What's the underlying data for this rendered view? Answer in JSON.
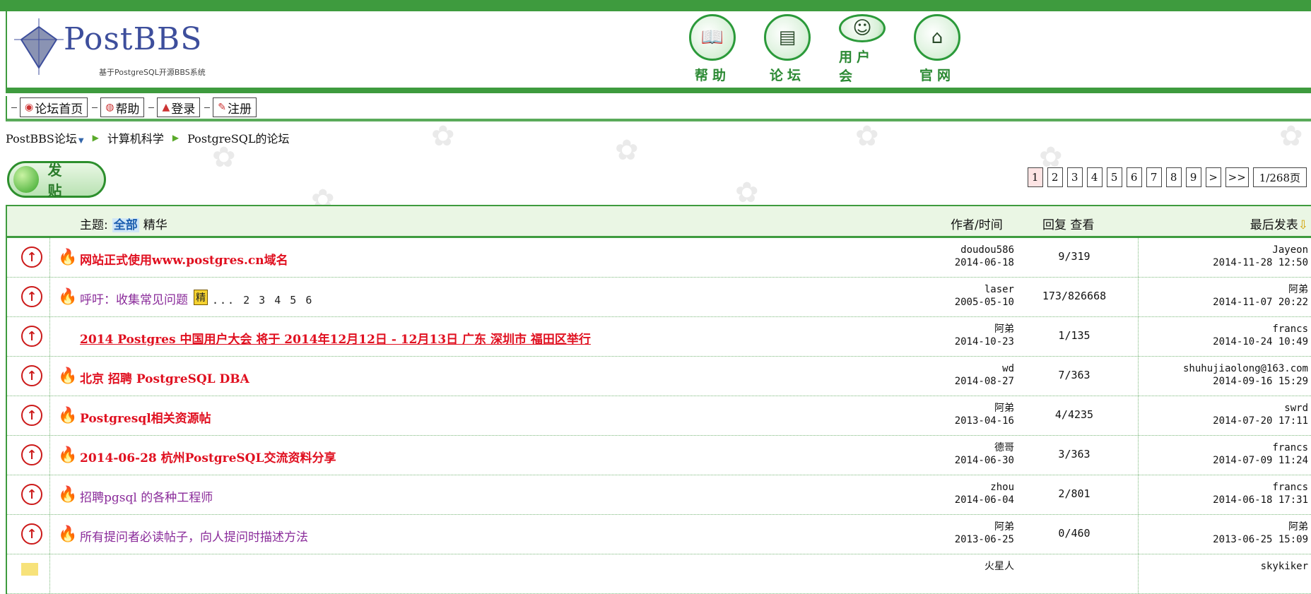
{
  "brand": {
    "title": "PostBBS",
    "subtitle": "基于PostgreSQL开源BBS系统"
  },
  "nav_icons": [
    {
      "label": "帮助",
      "icon": "book-icon"
    },
    {
      "label": "论坛",
      "icon": "board-icon"
    },
    {
      "label": "用户会",
      "icon": "users-icon"
    },
    {
      "label": "官网",
      "icon": "house-icon"
    }
  ],
  "menu": [
    "论坛首页",
    "帮助",
    "登录",
    "注册"
  ],
  "breadcrumb": [
    "PostBBS论坛",
    "计算机科学",
    "PostgreSQL的论坛"
  ],
  "post_button": "发 贴",
  "pager": {
    "pages": [
      "1",
      "2",
      "3",
      "4",
      "5",
      "6",
      "7",
      "8",
      "9"
    ],
    "next": ">",
    "last": ">>",
    "total": "1/268页",
    "current": "1"
  },
  "table_header": {
    "topic": "主题:",
    "tab_all": "全部",
    "tab_digest": "精华",
    "author": "作者/时间",
    "stats": "回复 查看",
    "last": "最后发表"
  },
  "topics": [
    {
      "title": "网站正式使用www.postgres.cn域名",
      "author": "doudou586",
      "date": "2014-06-18",
      "stats": "9/319",
      "last_user": "Jayeon",
      "last_time": "2014-11-28 12:50"
    },
    {
      "title": "呼吁：收集常见问题",
      "badge": "精",
      "more_pages": "... 2 3 4 5 6",
      "author": "laser",
      "date": "2005-05-10",
      "stats": "173/826668",
      "last_user": "阿弟",
      "last_time": "2014-11-07 20:22"
    },
    {
      "title": "2014 Postgres 中国用户大会 将于 2014年12月12日 - 12月13日 广东 深圳市 福田区举行",
      "author": "阿弟",
      "date": "2014-10-23",
      "stats": "1/135",
      "last_user": "francs",
      "last_time": "2014-10-24 10:49"
    },
    {
      "title": "北京 招聘 PostgreSQL DBA",
      "author": "wd",
      "date": "2014-08-27",
      "stats": "7/363",
      "last_user": "shuhujiaolong@163.com",
      "last_time": "2014-09-16 15:29"
    },
    {
      "title": "Postgresql相关资源帖",
      "author": "阿弟",
      "date": "2013-04-16",
      "stats": "4/4235",
      "last_user": "swrd",
      "last_time": "2014-07-20 17:11"
    },
    {
      "title": "2014-06-28 杭州PostgreSQL交流资料分享",
      "author": "德哥",
      "date": "2014-06-30",
      "stats": "3/363",
      "last_user": "francs",
      "last_time": "2014-07-09 11:24"
    },
    {
      "title": "招聘pgsql 的各种工程师",
      "author": "zhou",
      "date": "2014-06-04",
      "stats": "2/801",
      "last_user": "francs",
      "last_time": "2014-06-18 17:31"
    },
    {
      "title": "所有提问者必读帖子，向人提问时描述方法",
      "author": "阿弟",
      "date": "2013-06-25",
      "stats": "0/460",
      "last_user": "阿弟",
      "last_time": "2013-06-25 15:09"
    },
    {
      "title": "",
      "author": "火星人",
      "date": "",
      "stats": "",
      "last_user": "skykiker",
      "last_time": ""
    }
  ],
  "colors": {
    "green": "#3e9b3e",
    "title_red": "#e01020",
    "title_purple": "#8a2b9a"
  }
}
